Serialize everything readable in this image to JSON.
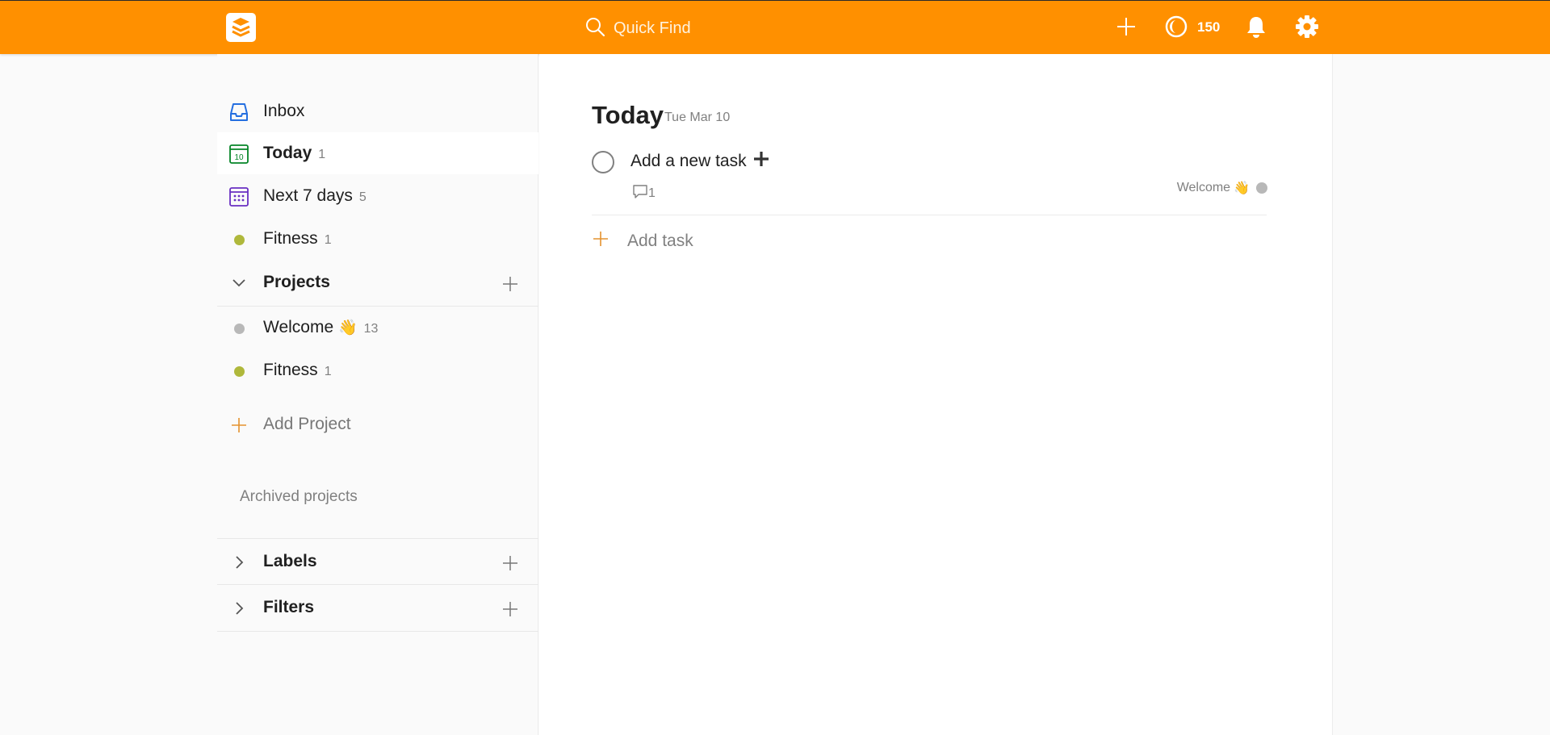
{
  "colors": {
    "brand": "#ff9000",
    "inbox_blue": "#246fe0",
    "today_green": "#058527",
    "upcoming_purple": "#692fc2",
    "fitness_olive": "#afb83b",
    "welcome_grey": "#b8b8b8",
    "accent_orange": "#e4922e"
  },
  "topbar": {
    "search_placeholder": "Quick Find",
    "karma_count": "150",
    "icons": [
      "logo-icon",
      "search-icon",
      "add-icon",
      "karma-icon",
      "bell-icon",
      "gear-icon"
    ]
  },
  "sidebar": {
    "filters": [
      {
        "label": "Inbox",
        "count": "",
        "icon": "inbox-icon"
      },
      {
        "label": "Today",
        "count": "1",
        "icon": "today-calendar-icon",
        "active": true,
        "calendar_day": "10"
      },
      {
        "label": "Next 7 days",
        "count": "5",
        "icon": "upcoming-calendar-icon"
      },
      {
        "label": "Fitness",
        "count": "1",
        "icon": "project-dot-icon"
      }
    ],
    "projects_header": "Projects",
    "projects": [
      {
        "label": "Welcome",
        "emoji": "👋",
        "count": "13"
      },
      {
        "label": "Fitness",
        "emoji": "",
        "count": "1"
      }
    ],
    "add_project_label": "Add Project",
    "archived_label": "Archived projects",
    "labels_header": "Labels",
    "filters_header": "Filters"
  },
  "main": {
    "title": "Today",
    "date": "Tue Mar 10",
    "tasks": [
      {
        "content": "Add a new task",
        "content_glyph": "➕",
        "comments": "1",
        "project": "Welcome",
        "project_emoji": "👋"
      }
    ],
    "add_task_label": "Add task"
  }
}
